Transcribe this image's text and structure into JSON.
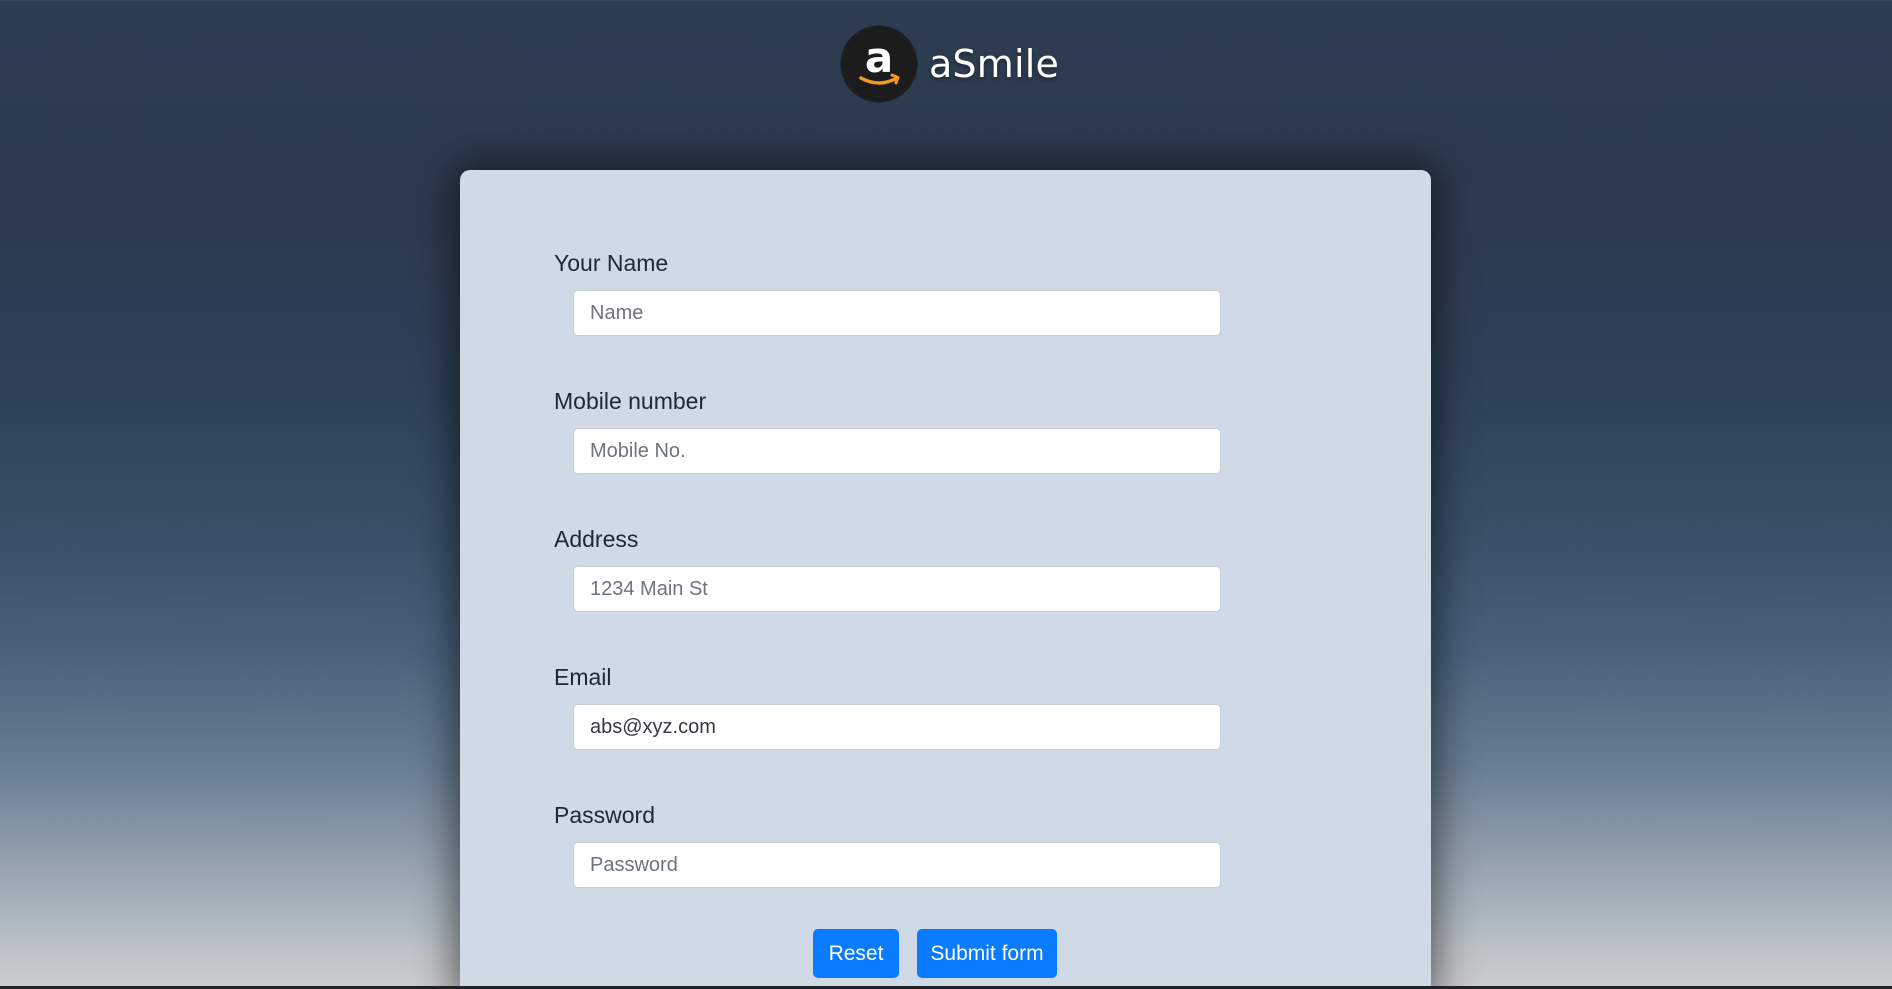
{
  "brand": {
    "logo_letter": "a",
    "logo_icon": "amazon-smile-icon",
    "name": "aSmile"
  },
  "form": {
    "fields": [
      {
        "label": "Your Name",
        "placeholder": "Name",
        "value": ""
      },
      {
        "label": "Mobile number",
        "placeholder": "Mobile No.",
        "value": ""
      },
      {
        "label": "Address",
        "placeholder": "1234 Main St",
        "value": ""
      },
      {
        "label": "Email",
        "placeholder": "",
        "value": "abs@xyz.com"
      },
      {
        "label": "Password",
        "placeholder": "Password",
        "value": ""
      }
    ],
    "buttons": {
      "reset": "Reset",
      "submit": "Submit form"
    }
  },
  "colors": {
    "card_background": "#cfdae6",
    "button_primary": "#0a7bff",
    "logo_smile": "#f29a1f"
  }
}
